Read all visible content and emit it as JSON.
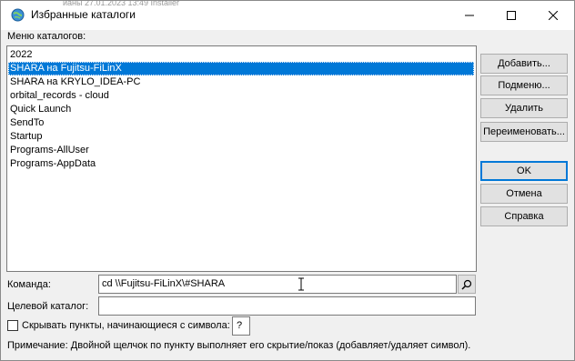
{
  "window": {
    "title": "Избранные каталоги",
    "background_strip": "ианы      27.01.2023 13:49              Installer"
  },
  "labels": {
    "menu_catalogs": "Меню каталогов:",
    "menu_catalogs_key": "н",
    "command": "Команда:",
    "command_key": "К",
    "target_dir": "Целевой каталог:",
    "target_dir_key": "Ц",
    "hide_items": "Скрывать пункты, начинающиеся с символа:",
    "hide_items_key": "С",
    "note": "Примечание: Двойной щелчок по пункту выполняет его скрытие/показ (добавляет/удаляет символ)."
  },
  "list": {
    "items": [
      "2022",
      "SHARA на Fujitsu-FiLinX",
      "SHARA на KRYLO_IDEA-PC",
      "orbital_records  -  cloud",
      "Quick Launch",
      "SendTo",
      "Startup",
      "Programs-AllUser",
      "Programs-AppData"
    ],
    "selected_index": 1
  },
  "buttons": {
    "add": "Добавить...",
    "submenu": "Подменю...",
    "delete": "Удалить",
    "rename": "Переименовать...",
    "ok": "OK",
    "cancel": "Отмена",
    "help": "Справка"
  },
  "fields": {
    "command_value": "cd \\\\Fujitsu-FiLinX\\#SHARA",
    "target_dir_value": "",
    "hide_char_value": "?",
    "hide_checked": false
  },
  "icons": {
    "app": "folder-globe-icon",
    "browse": "magnifier-icon",
    "minimize": "minimize-icon",
    "maximize": "maximize-icon",
    "close": "close-icon"
  },
  "colors": {
    "selection": "#0078d7",
    "default_button_border": "#0078d7"
  }
}
